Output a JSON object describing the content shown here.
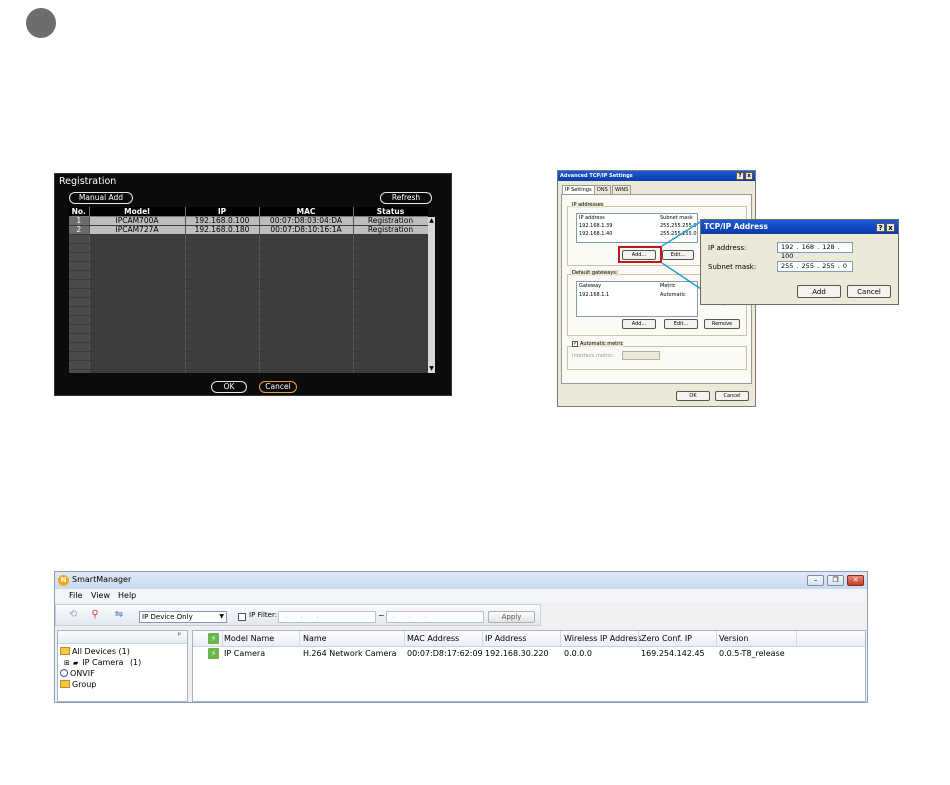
{
  "registration": {
    "title": "Registration",
    "manual_add": "Manual Add",
    "refresh": "Refresh",
    "columns": [
      "No.",
      "Model",
      "IP",
      "MAC",
      "Status"
    ],
    "rows": [
      {
        "no": "1",
        "model": "IPCAM700A",
        "ip": "192.168.0.100",
        "mac": "00:07:D8:03:04:DA",
        "status": "Registration"
      },
      {
        "no": "2",
        "model": "IPCAM727A",
        "ip": "192.168.0.180",
        "mac": "00:07:D8:10:16:1A",
        "status": "Registration"
      }
    ],
    "ok": "OK",
    "cancel": "Cancel"
  },
  "advanced_tcpip": {
    "title": "Advanced TCP/IP Settings",
    "help_btn": "?",
    "close_btn": "x",
    "tabs": [
      "IP Settings",
      "DNS",
      "WINS"
    ],
    "ip_addresses_group": "IP addresses",
    "ip_columns": [
      "IP address",
      "Subnet mask"
    ],
    "ip_rows": [
      {
        "ip": "192.168.1.39",
        "mask": "255.255.255.0"
      },
      {
        "ip": "192.168.1.40",
        "mask": "255.255.255.0"
      }
    ],
    "add_btn": "Add...",
    "edit_btn": "Edit...",
    "gateways_group": "Default gateways:",
    "gw_columns": [
      "Gateway",
      "Metric"
    ],
    "gw_rows": [
      {
        "gateway": "192.168.1.1",
        "metric": "Automatic"
      }
    ],
    "gw_add": "Add...",
    "gw_edit": "Edit...",
    "gw_remove": "Remove",
    "automatic_metric": "Automatic metric",
    "interface_metric": "Interface metric:",
    "ok": "OK",
    "cancel": "Cancel"
  },
  "tcpip_address": {
    "title": "TCP/IP Address",
    "help_btn": "?",
    "close_btn": "x",
    "ip_label": "IP address:",
    "ip_value": "192 . 168 . 128 . 100",
    "mask_label": "Subnet mask:",
    "mask_value": "255 . 255 . 255 . 0",
    "add": "Add",
    "cancel": "Cancel"
  },
  "smartmanager": {
    "title": "SmartManager",
    "logo": "N",
    "menu": [
      "File",
      "View",
      "Help"
    ],
    "device_filter": "IP Device Only",
    "ip_filter_label": "IP Filter:",
    "ip_from": ". . .",
    "ip_to": ". . .",
    "tilde": "~",
    "apply": "Apply",
    "tree": {
      "all_devices": "All Devices (1)",
      "ip_camera": "IP Camera",
      "ip_camera_count": "(1)",
      "onvif": "ONVIF",
      "group": "Group"
    },
    "columns": [
      "Model Name",
      "Name",
      "MAC Address",
      "IP Address",
      "Wireless IP Address",
      "Zero Conf. IP",
      "Version"
    ],
    "row": {
      "model_name": "IP Camera",
      "name": "H.264 Network Camera",
      "mac": "00:07:D8:17:62:09",
      "ip": "192.168.30.220",
      "wireless_ip": "0.0.0.0",
      "zero_conf_ip": "169.254.142.45",
      "version": "0.0.5-T8_release"
    },
    "btn_minimize": "–",
    "btn_restore": "❐",
    "btn_close": "✕",
    "pin": "ᵖ",
    "bolt": "⚡"
  },
  "colors": {
    "highlight": "#c3161c",
    "connector": "#2a9fd8",
    "xp_title": "#0a3aa8"
  }
}
